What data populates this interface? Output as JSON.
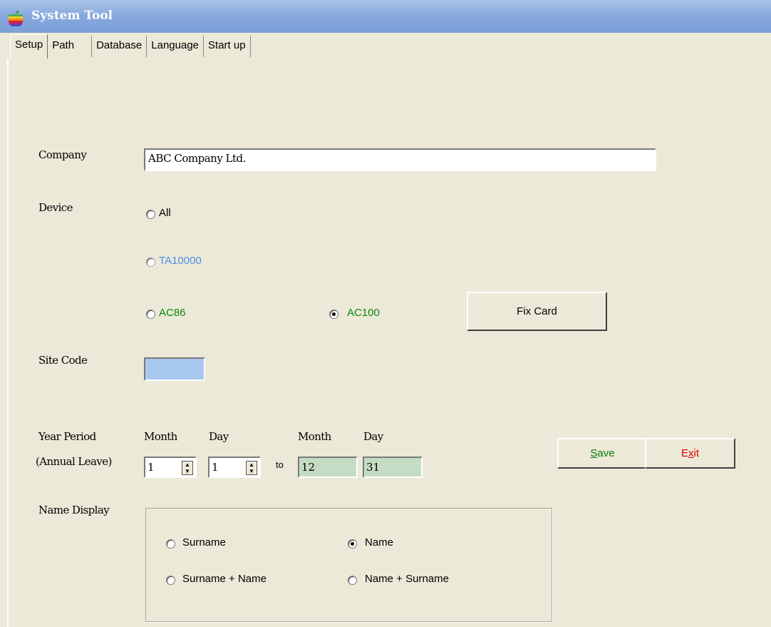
{
  "window": {
    "title": "System Tool",
    "icon": "apple-logo-icon"
  },
  "tabs": [
    {
      "label": "Setup",
      "active": true
    },
    {
      "label": "Path"
    },
    {
      "label": "Database"
    },
    {
      "label": "Language"
    },
    {
      "label": "Start up"
    }
  ],
  "company": {
    "label": "Company",
    "value": "ABC Company Ltd."
  },
  "device": {
    "label": "Device",
    "options": [
      {
        "label": "All",
        "selected": false,
        "color": "#000000"
      },
      {
        "label": "TA10000",
        "selected": false,
        "color": "#4a8fe8"
      },
      {
        "label": "AC86",
        "selected": false,
        "color": "#0a8a0a"
      },
      {
        "label": "AC100",
        "selected": true,
        "color": "#0a8a0a"
      }
    ],
    "fix_card_label": "Fix Card"
  },
  "site_code": {
    "label": "Site Code",
    "value": "",
    "bg_color": "#a9c8f0"
  },
  "year_period": {
    "label_line1": "Year Period",
    "label_line2": "(Annual Leave)",
    "from_month_header": "Month",
    "from_day_header": "Day",
    "to_month_header": "Month",
    "to_day_header": "Day",
    "from_month": "1",
    "from_day": "1",
    "to_label": "to",
    "to_month": "12",
    "to_day": "31"
  },
  "actions": {
    "save_label": "Save",
    "save_mnemonic": "S",
    "save_rest": "ave",
    "save_color": "#0a7a0a",
    "exit_label": "Exit",
    "exit_before": "E",
    "exit_mnemonic": "x",
    "exit_after": "it",
    "exit_color": "#e00000"
  },
  "name_display": {
    "label": "Name Display",
    "options": [
      {
        "label": "Surname",
        "selected": false
      },
      {
        "label": "Name",
        "selected": true
      },
      {
        "label": "Surname + Name",
        "selected": false
      },
      {
        "label": "Name + Surname",
        "selected": false
      }
    ]
  }
}
